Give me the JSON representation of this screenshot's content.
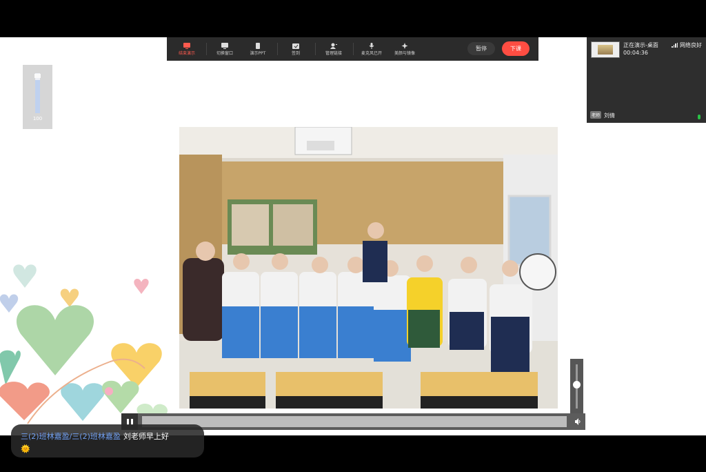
{
  "toolbar": {
    "items": [
      {
        "label": "结束演示",
        "icon": "stop-share-icon"
      },
      {
        "label": "切换窗口",
        "icon": "switch-window-icon"
      },
      {
        "label": "演示PPT",
        "icon": "ppt-icon"
      },
      {
        "label": "签到",
        "icon": "check-in-icon"
      },
      {
        "label": "管理链接",
        "icon": "manage-link-icon"
      },
      {
        "label": "麦克风已开",
        "icon": "microphone-icon"
      },
      {
        "label": "美颜与镜像",
        "icon": "beauty-icon"
      }
    ],
    "pause_label": "暂停",
    "end_class_label": "下课"
  },
  "presenter_panel": {
    "status": "正在演示-桌面",
    "timer": "00:04:36",
    "network": "网络良好",
    "role_badge": "老师",
    "teacher_name": "刘倩"
  },
  "volume_left": {
    "value": "100",
    "level": 0.82
  },
  "video": {
    "state": "paused",
    "volume_level": 0.55
  },
  "chat": {
    "sender": "三(2)班林嘉盈/三(2)班林嘉盈",
    "message": "刘老师早上好",
    "emoji": "🌞"
  },
  "colors": {
    "accent": "#ff4d42",
    "toolbar_bg": "#2b2b2b",
    "chat_sender": "#6f9ef0"
  }
}
